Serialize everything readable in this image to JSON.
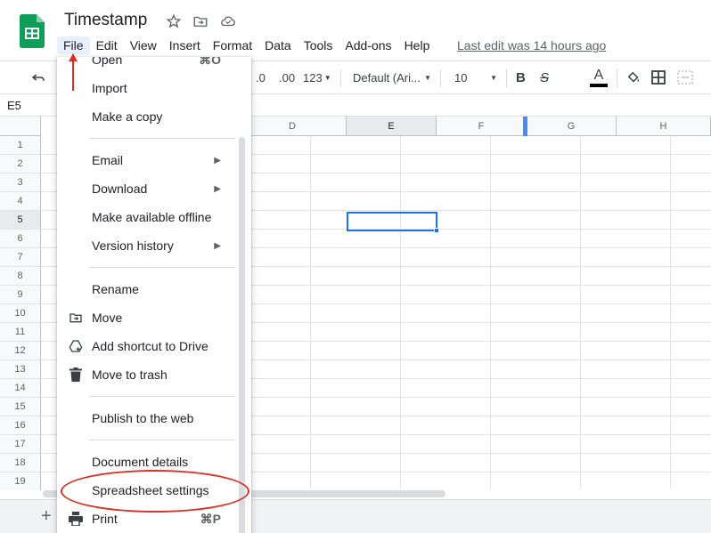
{
  "app": {
    "title": "Timestamp",
    "last_edit": "Last edit was 14 hours ago"
  },
  "menubar": [
    "File",
    "Edit",
    "View",
    "Insert",
    "Format",
    "Data",
    "Tools",
    "Add-ons",
    "Help"
  ],
  "toolbar": {
    "decimal_decrease": ".0",
    "decimal_increase": ".00",
    "format_more": "123",
    "font": "Default (Ari...",
    "font_size": "10",
    "bold": "B",
    "strikethrough": "S",
    "text_color": "A"
  },
  "formula_bar": {
    "cell_ref": "E5"
  },
  "grid": {
    "columns": [
      "D",
      "E",
      "F",
      "G",
      "H"
    ],
    "rows": [
      "1",
      "2",
      "3",
      "4",
      "5",
      "6",
      "7",
      "8",
      "9",
      "10",
      "11",
      "12",
      "13",
      "14",
      "15",
      "16",
      "17",
      "18",
      "19"
    ],
    "selected_cell": "E5",
    "selected_column": "E",
    "selected_row": "5"
  },
  "file_menu": {
    "items": [
      {
        "label": "Open",
        "shortcut": "⌘O"
      },
      {
        "label": "Import"
      },
      {
        "label": "Make a copy"
      },
      {
        "label": "Email",
        "submenu": true
      },
      {
        "label": "Download",
        "submenu": true
      },
      {
        "label": "Make available offline"
      },
      {
        "label": "Version history",
        "submenu": true
      },
      {
        "label": "Rename"
      },
      {
        "label": "Move",
        "icon": "move-folder-icon"
      },
      {
        "label": "Add shortcut to Drive",
        "icon": "drive-shortcut-icon"
      },
      {
        "label": "Move to trash",
        "icon": "trash-icon"
      },
      {
        "label": "Publish to the web"
      },
      {
        "label": "Document details"
      },
      {
        "label": "Spreadsheet settings"
      },
      {
        "label": "Print",
        "shortcut": "⌘P",
        "icon": "print-icon"
      }
    ]
  },
  "bottom_bar": {
    "add_sheet": "+"
  },
  "colors": {
    "accent": "#1a73e8",
    "sheets_green": "#0f9d58",
    "annotation_red": "#d93025"
  }
}
